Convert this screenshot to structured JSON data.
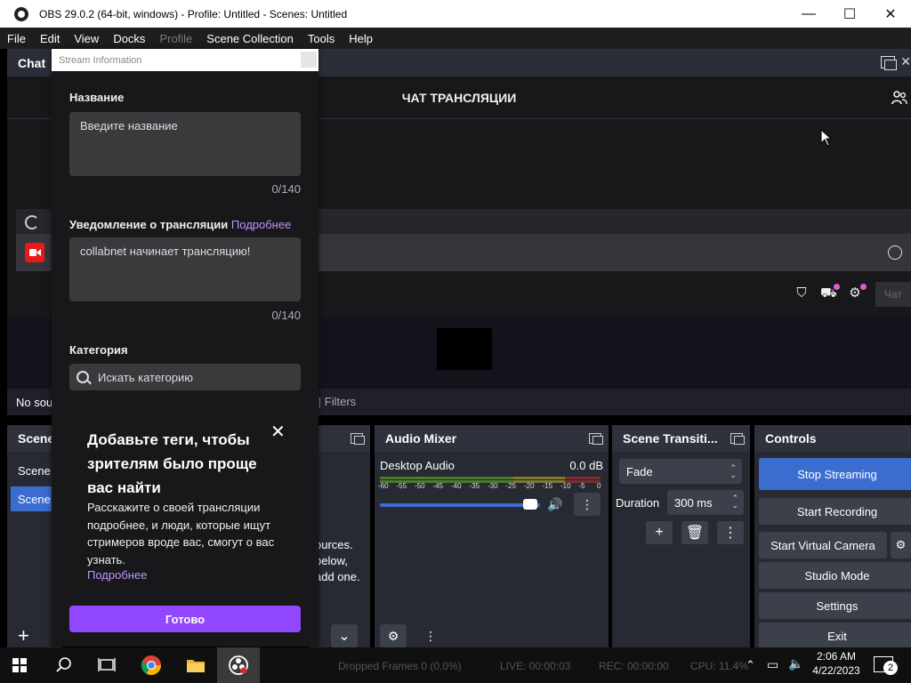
{
  "window": {
    "title": "OBS 29.0.2 (64-bit, windows) - Profile: Untitled - Scenes: Untitled",
    "minimize": "—",
    "maximize": "☐",
    "close": "✕"
  },
  "menu": [
    "File",
    "Edit",
    "View",
    "Docks",
    "Profile",
    "Scene Collection",
    "Tools",
    "Help"
  ],
  "chat_dock": {
    "label": "Chat",
    "header": "ЧАТ ТРАНСЛЯЦИИ",
    "send_label": "Чат"
  },
  "sources": {
    "empty_text": "No sou",
    "filters_label": "Filters",
    "hint_lines": [
      "ources.",
      "below,",
      "add one."
    ]
  },
  "scenes": {
    "label": "Scene",
    "items": [
      "Scene",
      "Scene"
    ],
    "add": "+"
  },
  "audio_mixer": {
    "label": "Audio Mixer",
    "channel": "Desktop Audio",
    "level": "0.0 dB",
    "ticks": [
      "-60",
      "-55",
      "-50",
      "-45",
      "-40",
      "-35",
      "-30",
      "-25",
      "-20",
      "-15",
      "-10",
      "-5",
      "0"
    ],
    "volume_fraction": 0.97
  },
  "transitions": {
    "label": "Scene Transiti...",
    "selected": "Fade",
    "duration_label": "Duration",
    "duration_value": "300 ms"
  },
  "controls": {
    "label": "Controls",
    "buttons": [
      "Stop Streaming",
      "Start Recording",
      "Start Virtual Camera",
      "Studio Mode",
      "Settings",
      "Exit"
    ]
  },
  "stream_info": {
    "window_title": "Stream Information",
    "title_label": "Название",
    "title_placeholder": "Введите название",
    "title_counter": "0/140",
    "notify_label": "Уведомление о трансляции",
    "notify_link": "Подробнее",
    "notify_value": "collabnet начинает трансляцию!",
    "notify_counter": "0/140",
    "category_label": "Категория",
    "category_placeholder": "Искать категорию",
    "tip_heading": "Добавьте теги, чтобы зрителям было проще вас найти",
    "tip_body": "Расскажите о своей трансляции подробнее, и люди, которые ищут стримеров вроде вас, смогут о вас узнать.",
    "tip_link": "Подробнее",
    "done_label": "Готово"
  },
  "statusbar": {
    "dropped": "Dropped Frames 0 (0.0%)",
    "live": "LIVE: 00:00:03",
    "rec": "REC: 00:00:00",
    "cpu": "CPU: 11.4%"
  },
  "taskbar": {
    "time": "2:06 AM",
    "date": "4/22/2023",
    "notifications": "2"
  },
  "colors": {
    "accent_blue": "#3b6dd1",
    "twitch_purple": "#9147ff",
    "link_purple": "#bf94ff"
  }
}
